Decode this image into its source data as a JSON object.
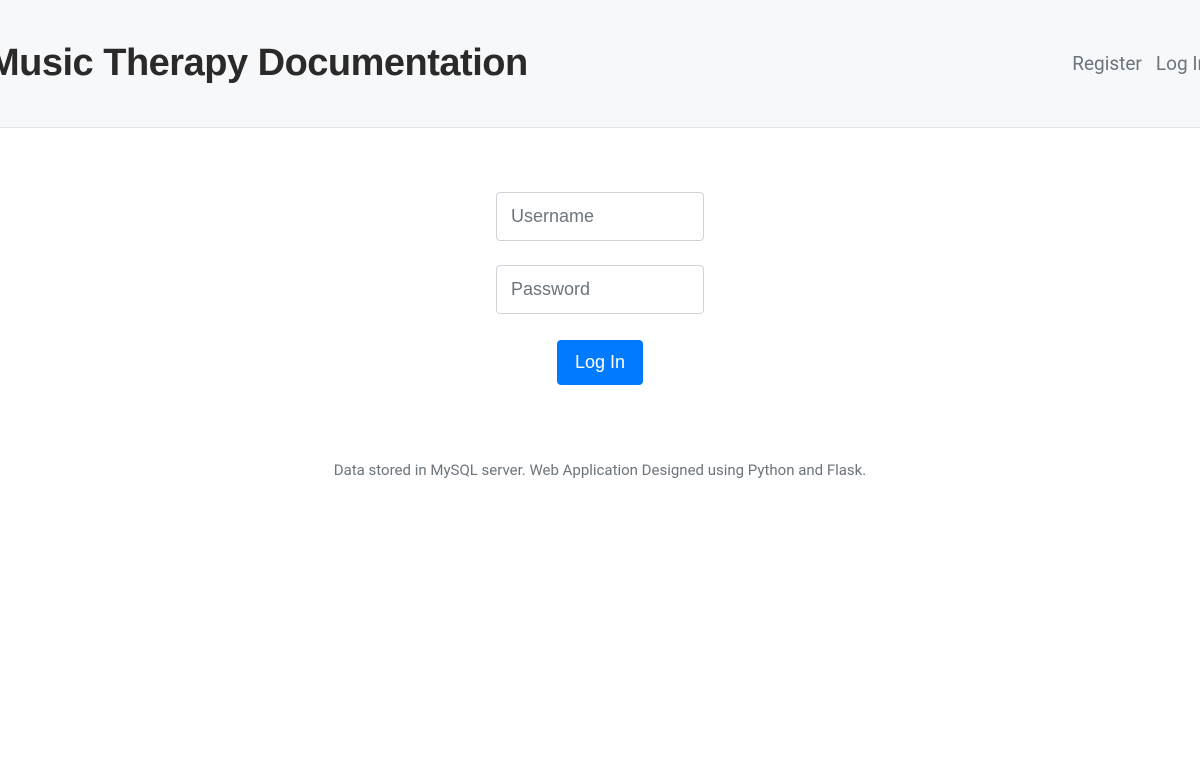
{
  "header": {
    "title": "Music Therapy Documentation",
    "nav": {
      "register": "Register",
      "login": "Log In"
    }
  },
  "form": {
    "username_placeholder": "Username",
    "password_placeholder": "Password",
    "login_button": "Log In"
  },
  "footer": {
    "text": "Data stored in MySQL server. Web Application Designed using Python and Flask."
  }
}
